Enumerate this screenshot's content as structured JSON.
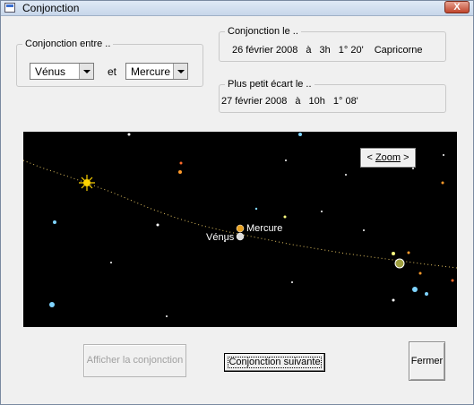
{
  "window": {
    "title": "Conjonction",
    "close_label": "X"
  },
  "selection": {
    "legend": "Conjonction entre ..",
    "planet1": "Vénus",
    "connector": "et",
    "planet2": "Mercure"
  },
  "conjunction": {
    "legend": "Conjonction le ..",
    "date": "26 février 2008",
    "at": "à",
    "hour": "3h",
    "angle": "1° 20'",
    "sign": "Capricorne"
  },
  "smallest_gap": {
    "legend": "Plus petit écart le ..",
    "date": "27 février 2008",
    "at": "à",
    "hour": "10h",
    "angle": "1° 08'"
  },
  "sky": {
    "zoom_label_prefix": "<",
    "zoom_label": "Zoom",
    "zoom_label_suffix": ">",
    "label_mercure": "Mercure",
    "label_venus": "Vénus"
  },
  "buttons": {
    "afficher": "Afficher la conjonction",
    "suivante": "Conjonction suivante",
    "fermer": "Fermer"
  },
  "colors": {
    "sky_background": "#000000",
    "ecliptic": "#e0c060",
    "sun": "#ffd400",
    "star_blue": "#7fd4ff",
    "star_orange": "#ff9a2a"
  }
}
